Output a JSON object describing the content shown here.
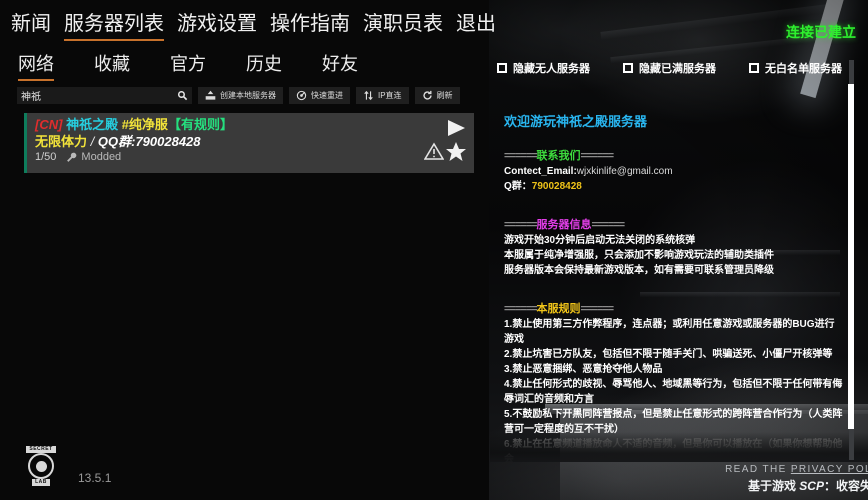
{
  "main_nav": [
    {
      "label": "新闻",
      "active": false
    },
    {
      "label": "服务器列表",
      "active": true
    },
    {
      "label": "游戏设置",
      "active": false
    },
    {
      "label": "操作指南",
      "active": false
    },
    {
      "label": "演职员表",
      "active": false
    },
    {
      "label": "退出",
      "active": false
    }
  ],
  "sub_nav": [
    {
      "label": "网络",
      "active": true
    },
    {
      "label": "收藏",
      "active": false
    },
    {
      "label": "官方",
      "active": false
    },
    {
      "label": "历史",
      "active": false
    },
    {
      "label": "好友",
      "active": false
    }
  ],
  "toolbar": {
    "search_value": "神祇",
    "search_placeholder": "",
    "search_icon": "search-icon",
    "buttons": [
      {
        "label": "创建本地服务器",
        "icon": "host-server-icon"
      },
      {
        "label": "快速重进",
        "icon": "rejoin-icon"
      },
      {
        "label": "IP直连",
        "icon": "direct-connect-icon"
      },
      {
        "label": "刷新",
        "icon": "refresh-icon"
      }
    ]
  },
  "server_row": {
    "tag": "[CN]",
    "name": "神祇之殿",
    "pure_tag": "#纯净服",
    "rule_tag": "【有规则】",
    "mode": "无限体力",
    "separator": "/",
    "qq_group": "QQ群:790028428",
    "players": "1/50",
    "modded": "Modded",
    "icons": {
      "play": "play-icon",
      "warning": "warning-icon",
      "favorite": "star-icon"
    }
  },
  "filters": [
    {
      "label": "隐藏无人服务器",
      "checked": false
    },
    {
      "label": "隐藏已满服务器",
      "checked": false
    },
    {
      "label": "无白名单服务器",
      "checked": false
    }
  ],
  "connection_status": "连接已建立",
  "info_panel": {
    "title": "欢迎游玩神祇之殿服务器",
    "sections": [
      {
        "head_prefix": "======",
        "head": "联系我们",
        "head_suffix": "======",
        "head_color_class": "h-contact",
        "lines": [
          {
            "key": "Contect_Email:",
            "val": "wjxkinlife@gmail.com"
          },
          {
            "key": "Q群：",
            "val": "790028428",
            "val_class": "amber"
          }
        ]
      },
      {
        "head_prefix": "======",
        "head": "服务器信息",
        "head_suffix": "======",
        "head_color_class": "h-info",
        "lines": [
          {
            "key": "游戏开始30分钟后启动无法关闭的系统核弹",
            "val": ""
          },
          {
            "key": "本服属于纯净增强服，只会添加不影响游戏玩法的辅助类插件",
            "val": ""
          },
          {
            "key": "服务器版本会保持最新游戏版本，如有需要可联系管理员降级",
            "val": ""
          }
        ]
      },
      {
        "head_prefix": "======",
        "head": "本服规则",
        "head_suffix": "======",
        "head_color_class": "h-rules",
        "lines": [
          {
            "key": "1.禁止使用第三方作弊程序，连点器；或利用任意游戏或服务器的BUG进行游戏",
            "val": ""
          },
          {
            "key": "2.禁止坑害已方队友，包括但不限于随手关门、哄骗送死、小僵尸开核弹等",
            "val": ""
          },
          {
            "key": "3.禁止恶意捆绑、恶意抢夺他人物品",
            "val": ""
          },
          {
            "key": "4.禁止任何形式的歧视、辱骂他人、地域黑等行为，包括但不限于任何带有侮辱词汇的音频和方言",
            "val": ""
          },
          {
            "key": "5.不鼓励私下开黑同阵营报点，但是禁止任意形式的跨阵营合作行为（人类阵营可一定程度的互不干扰）",
            "val": ""
          },
          {
            "key": "6.禁止在任意频道播放命人不适的音频，但是你可以播放在（如果你想帮助他会",
            "val": "",
            "faded": true
          }
        ]
      }
    ]
  },
  "footer": {
    "logo_top": "SECRET",
    "logo_bottom": "LAB",
    "version": "13.5.1",
    "privacy_prefix": "READ THE ",
    "privacy_link": "PRIVACY POL",
    "based_on_prefix": "基于游戏 ",
    "based_on_game": "SCP",
    "based_on_suffix": "：收容失"
  },
  "colors": {
    "accent_underline": "#c8722c",
    "title_blue": "#29b6f0",
    "status_green": "#2ef02e",
    "amber": "#f0c419",
    "server_accent": "#0e7d5c"
  }
}
